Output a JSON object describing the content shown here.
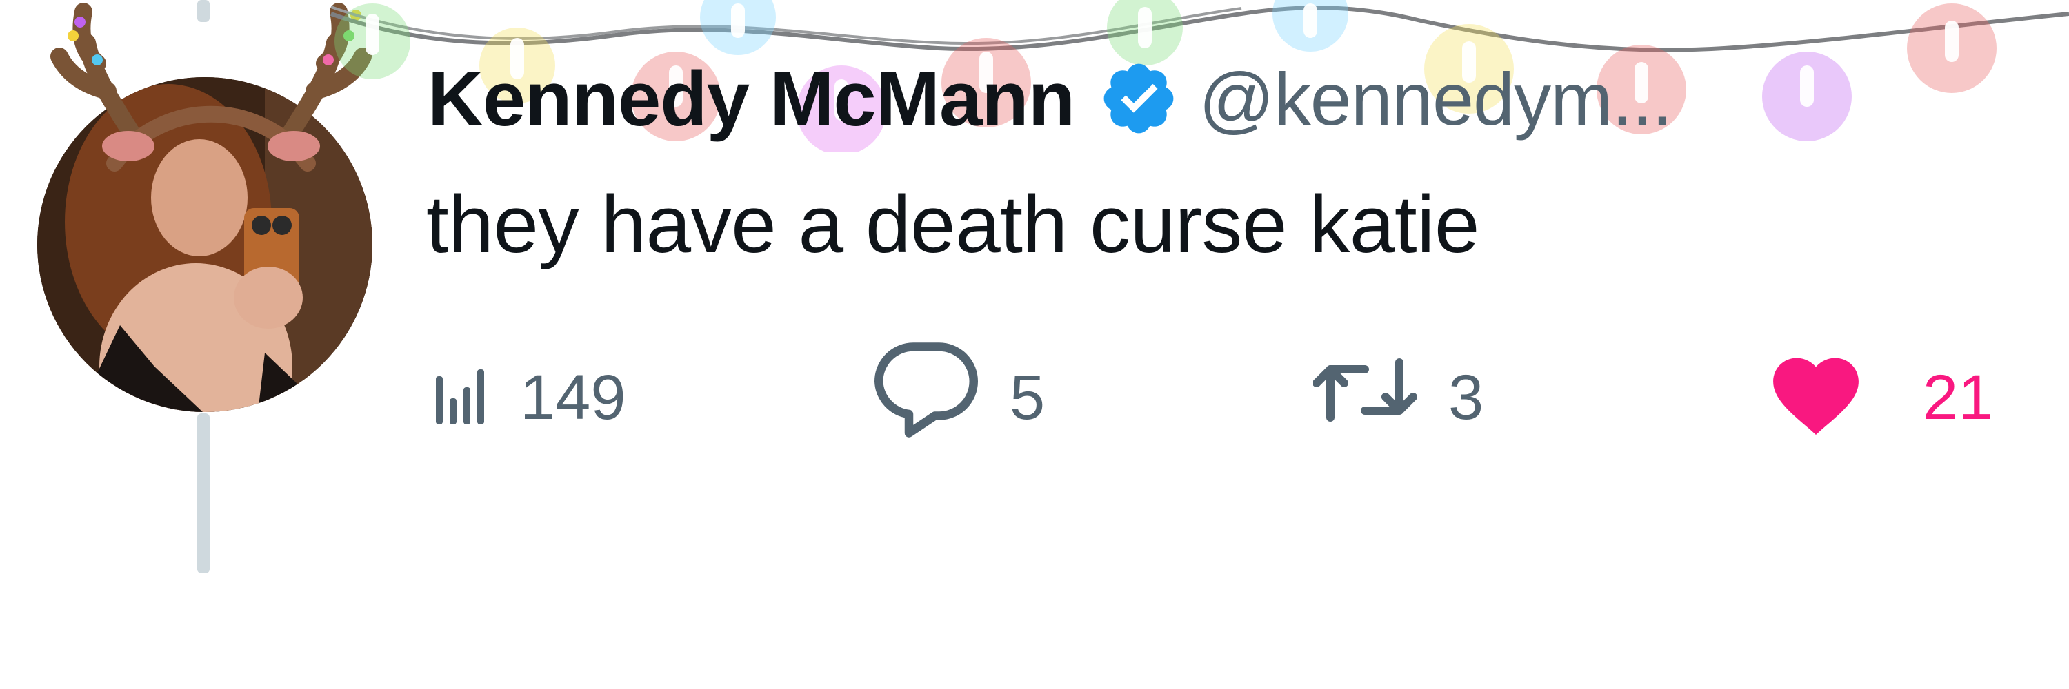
{
  "tweet": {
    "author": {
      "display_name": "Kennedy McMann",
      "handle": "@kennedym...",
      "verified": true,
      "verified_icon": "verified-badge-icon",
      "avatar_alt": "profile photo"
    },
    "text": "they have a death curse katie",
    "metrics": {
      "views": {
        "icon": "views-bar-chart-icon",
        "count": "149"
      },
      "replies": {
        "icon": "reply-bubble-icon",
        "count": "5"
      },
      "reposts": {
        "icon": "repost-arrows-icon",
        "count": "3"
      },
      "likes": {
        "icon": "heart-icon",
        "count": "21",
        "liked": true
      }
    }
  },
  "colors": {
    "text_primary": "#0f1419",
    "text_secondary": "#536471",
    "verified_blue": "#1d9bf0",
    "like_pink": "#f91880",
    "thread_line": "#cfd9de"
  },
  "decorations": {
    "garland": "christmas-lights-garland",
    "antlers": "reindeer-antlers-overlay"
  }
}
